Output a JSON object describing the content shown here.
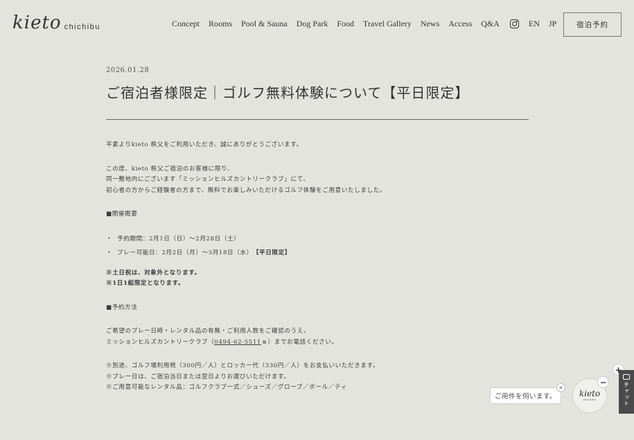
{
  "header": {
    "logo_main": "kieto",
    "logo_sub": "chichibu",
    "nav": [
      "Concept",
      "Rooms",
      "Pool & Sauna",
      "Dog Park",
      "Food",
      "Travel Gallery",
      "News",
      "Access",
      "Q&A"
    ],
    "instagram_icon": "instagram-icon",
    "lang_en": "EN",
    "lang_jp": "JP",
    "reserve_label": "宿泊予約"
  },
  "article": {
    "date": "2026.01.28",
    "title": "ご宿泊者様限定｜ゴルフ無料体験について【平日限定】",
    "intro": "平素よりkieto 秩父をご利用いただき、誠にありがとうございます。",
    "para1": [
      "この度、kieto 秩父ご宿泊のお客様に限り、",
      "同一敷地内にございます「ミッションヒルズカントリークラブ」にて、",
      "初心者の方からご経験者の方まで、無料でお楽しみいただけるゴルフ体験をご用意いたしました。"
    ],
    "section1": "■開催概要",
    "bullet_mark": "・",
    "bullet1": "予約期間：2月1日（日）〜2月28日（土）",
    "bullet2_text": "プレー可能日：2月2日（月）〜3月18日（水）",
    "bullet2_bold": "【平日限定】",
    "note1": "※土日祝は、対象外となります。",
    "note2": "※1日1組限定となります。",
    "section2": "■予約方法",
    "para2_line1": "ご希望のプレー日時・レンタル品の有無・ご利用人数をご確認のうえ、",
    "para2_line2_pre": "ミッションヒルズカントリークラブ（",
    "para2_phone": "0494-62-5511",
    "para2_line2_post": "）までお電話ください。",
    "para3": [
      "※別途、ゴルフ場利用税（300円／人）とロッカー代（330円／人）をお支払いいただきます。",
      "※プレー日は、ご宿泊当日または翌日よりお選びいただけます。",
      "※ご用意可能なレンタル品：ゴルフクラブ一式／シューズ／グローブ／ボール／ティ"
    ]
  },
  "chat": {
    "bubble": "ご用件を伺います。",
    "close": "×",
    "avatar_logo": "kieto",
    "avatar_sub": "chichibu",
    "minus": "−",
    "plus": "+",
    "tab_label": "チャット"
  },
  "colors": {
    "background": "#e4e4df",
    "text": "#3a3a3a",
    "chat_tab": "#4a4a4a"
  }
}
